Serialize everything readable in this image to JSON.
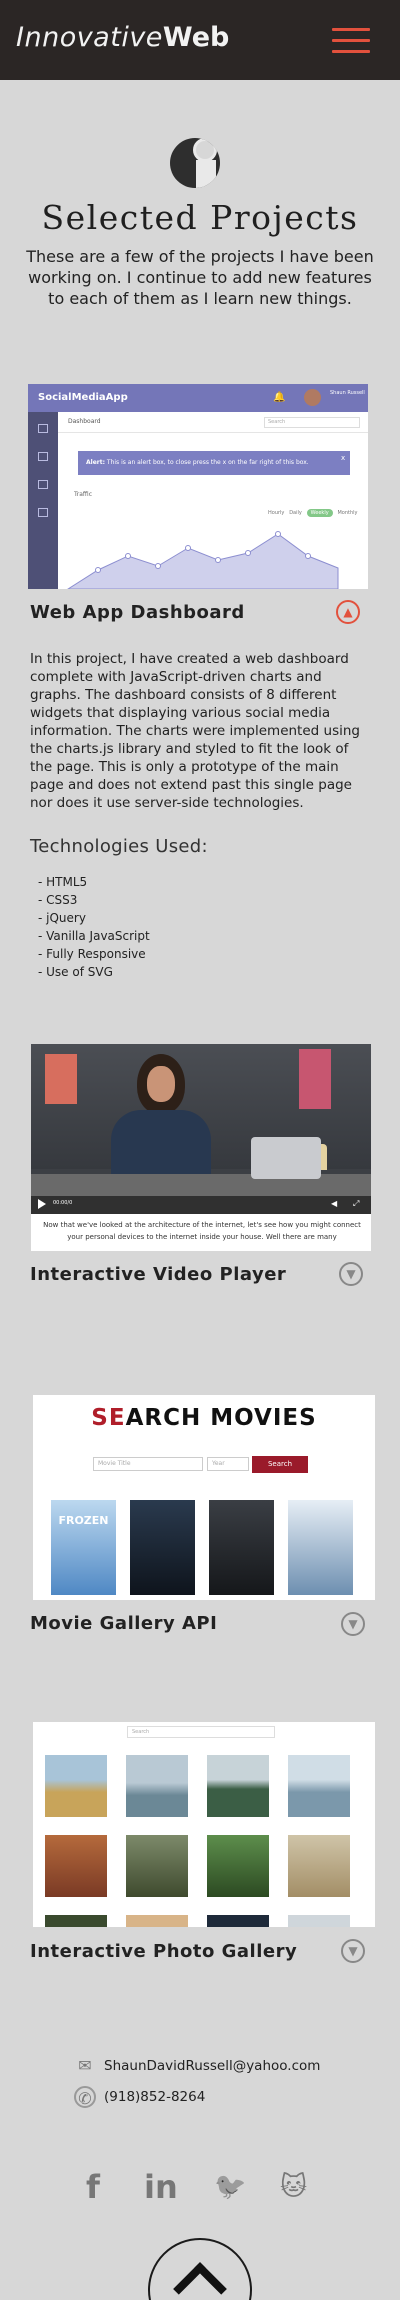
{
  "header": {
    "logo_light": "Innovative",
    "logo_bold": "Web",
    "menu_icon": "hamburger-menu-icon",
    "accent_color": "#e2513d"
  },
  "intro": {
    "icon": "person-info-icon",
    "title": "Selected Projects",
    "text": "These are a few of the projects I have been working on. I continue to add new features to each of them as I learn new things."
  },
  "projects": [
    {
      "title": "Web App Dashboard",
      "toggle_icon": "chevron-up-icon",
      "expanded": true,
      "screenshot": {
        "brand": "SocialMediaApp",
        "user": "Shaun Russell",
        "tab": "Dashboard",
        "search_placeholder": "Search",
        "alert_bold": "Alert:",
        "alert_text": "This is an alert box, to close press the x on the far right of this box.",
        "alert_close": "x",
        "traffic_label": "Traffic",
        "ranges": [
          "Hourly",
          "Daily",
          "Weekly",
          "Monthly"
        ],
        "active_range": "Weekly"
      },
      "description": "In this project, I have created a web dashboard complete with JavaScript-driven charts and graphs. The dashboard consists of 8 different widgets that displaying various social media information. The charts were implemented using the charts.js library and styled to fit the look of the page. This is only a prototype of the main page and does not extend past this single page nor does it use server-side technologies.",
      "tech_heading": "Technologies Used:",
      "technologies": [
        "- HTML5",
        "- CSS3",
        "- jQuery",
        "- Vanilla JavaScript",
        "- Fully Responsive",
        "- Use of SVG"
      ]
    },
    {
      "title": "Interactive Video Player",
      "toggle_icon": "chevron-down-icon",
      "screenshot": {
        "time": "00:00/0",
        "caption": "Now that we've looked at the architecture of the internet, let's see how you might connect your personal devices to the internet inside your house. Well there are many"
      }
    },
    {
      "title": "Movie Gallery API",
      "toggle_icon": "chevron-down-icon",
      "screenshot": {
        "title_accent": "SE",
        "title_rest": "ARCH MOVIES",
        "title_placeholder": "Movie Title",
        "year_placeholder": "Year",
        "button": "Search",
        "poster_title": "FROZEN"
      }
    },
    {
      "title": "Interactive Photo Gallery",
      "toggle_icon": "chevron-down-icon",
      "screenshot": {
        "search_placeholder": "Search"
      }
    }
  ],
  "contact": {
    "email_icon": "envelope-icon",
    "email": "ShaunDavidRussell@yahoo.com",
    "phone_icon": "phone-icon",
    "phone": "(918)852-8264"
  },
  "social": [
    {
      "icon": "facebook-icon",
      "glyph": "f"
    },
    {
      "icon": "linkedin-icon",
      "glyph": "in"
    },
    {
      "icon": "twitter-icon",
      "glyph": "🐦"
    },
    {
      "icon": "github-icon",
      "glyph": "🐱"
    }
  ],
  "back_to_top_icon": "chevron-up-icon"
}
